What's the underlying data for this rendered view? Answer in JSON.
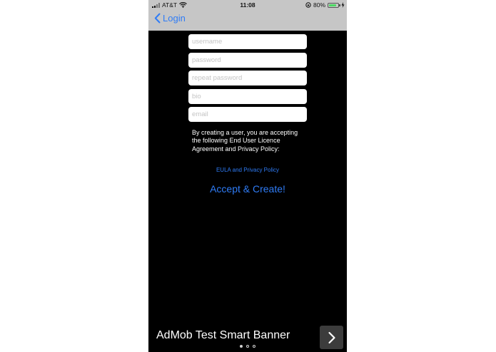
{
  "status_bar": {
    "carrier": "AT&T",
    "time": "11:08",
    "battery_percent": "80%",
    "battery_level": 0.8
  },
  "nav": {
    "back_label": "Login",
    "accent_color": "#2f7cf6"
  },
  "form": {
    "fields": [
      {
        "placeholder": "username",
        "value": ""
      },
      {
        "placeholder": "password",
        "value": ""
      },
      {
        "placeholder": "repeat password",
        "value": ""
      },
      {
        "placeholder": "bio",
        "value": ""
      },
      {
        "placeholder": "email",
        "value": ""
      }
    ],
    "terms_text": "By creating a user, you are accepting the following End User Licence Agreement and Privacy Policy:",
    "eula_link": "EULA and Privacy Policy",
    "accept_button": "Accept & Create!"
  },
  "ad": {
    "text": "AdMob Test Smart Banner",
    "arrow_icon": "chevron-right-icon",
    "page_count": 3,
    "active_page": 0
  }
}
